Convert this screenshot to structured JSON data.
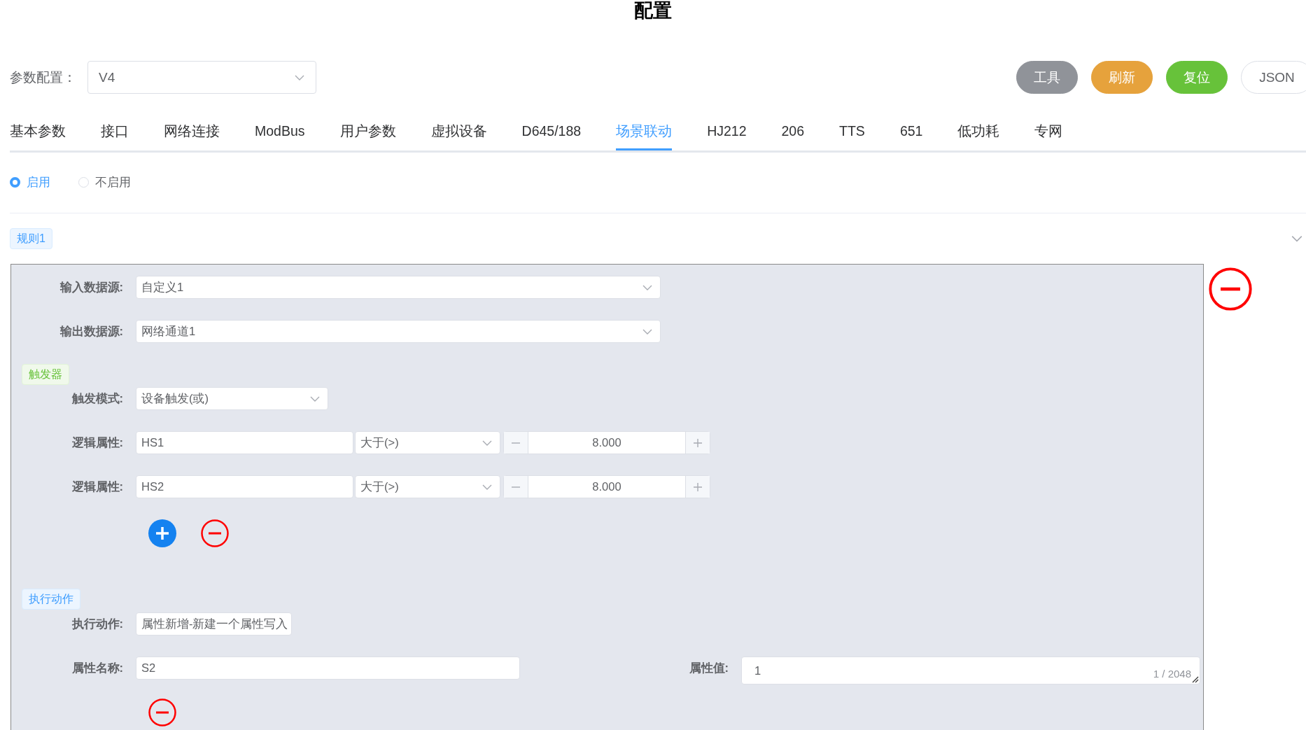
{
  "title": "配置",
  "param_config": {
    "label": "参数配置：",
    "value": "V4"
  },
  "buttons": [
    {
      "label": "工具",
      "kind": "info"
    },
    {
      "label": "刷新",
      "kind": "warning"
    },
    {
      "label": "复位",
      "kind": "success"
    },
    {
      "label": "JSON",
      "kind": "plain"
    }
  ],
  "tabs": [
    {
      "label": "基本参数",
      "selected": false
    },
    {
      "label": "接口",
      "selected": false
    },
    {
      "label": "网络连接",
      "selected": false
    },
    {
      "label": "ModBus",
      "selected": false
    },
    {
      "label": "用户参数",
      "selected": false
    },
    {
      "label": "虚拟设备",
      "selected": false
    },
    {
      "label": "D645/188",
      "selected": false
    },
    {
      "label": "场景联动",
      "selected": true
    },
    {
      "label": "HJ212",
      "selected": false
    },
    {
      "label": "206",
      "selected": false
    },
    {
      "label": "TTS",
      "selected": false
    },
    {
      "label": "651",
      "selected": false
    },
    {
      "label": "低功耗",
      "selected": false
    },
    {
      "label": "专网",
      "selected": false
    }
  ],
  "enable_options": [
    {
      "label": "启用",
      "selected": true
    },
    {
      "label": "不启用",
      "selected": false
    }
  ],
  "rule": {
    "tag": "规则1",
    "input_source": {
      "label": "输入数据源:",
      "value": "自定义1"
    },
    "output_source": {
      "label": "输出数据源:",
      "value": "网络通道1"
    },
    "trigger": {
      "tag": "触发器",
      "mode": {
        "label": "触发模式:",
        "value": "设备触发(或)"
      },
      "conditions": [
        {
          "label": "逻辑属性:",
          "property": "HS1",
          "operator": "大于(>)",
          "value": "8.000"
        },
        {
          "label": "逻辑属性:",
          "property": "HS2",
          "operator": "大于(>)",
          "value": "8.000"
        }
      ]
    },
    "action": {
      "tag": "执行动作",
      "type": {
        "label": "执行动作:",
        "value": "属性新增-新建一个属性写入"
      },
      "attribute_name": {
        "label": "属性名称:",
        "value": "S2"
      },
      "attribute_value": {
        "label": "属性值:",
        "value": "1",
        "counter": "1 / 2048"
      }
    }
  }
}
